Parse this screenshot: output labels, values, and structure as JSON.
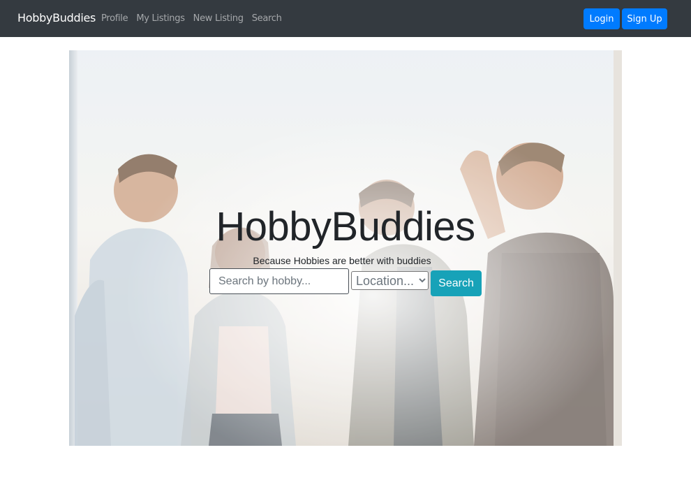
{
  "navbar": {
    "brand": "HobbyBuddies",
    "links": [
      {
        "label": "Profile"
      },
      {
        "label": "My Listings"
      },
      {
        "label": "New Listing"
      },
      {
        "label": "Search"
      }
    ],
    "login_label": "Login",
    "signup_label": "Sign Up",
    "bg_color": "#343a40",
    "button_color": "#007bff"
  },
  "hero": {
    "title": "HobbyBuddies",
    "tagline": "Because Hobbies are better with buddies",
    "search_placeholder": "Search by hobby...",
    "location_selected": "Location...",
    "search_button": "Search",
    "search_button_color": "#17a2b8"
  }
}
